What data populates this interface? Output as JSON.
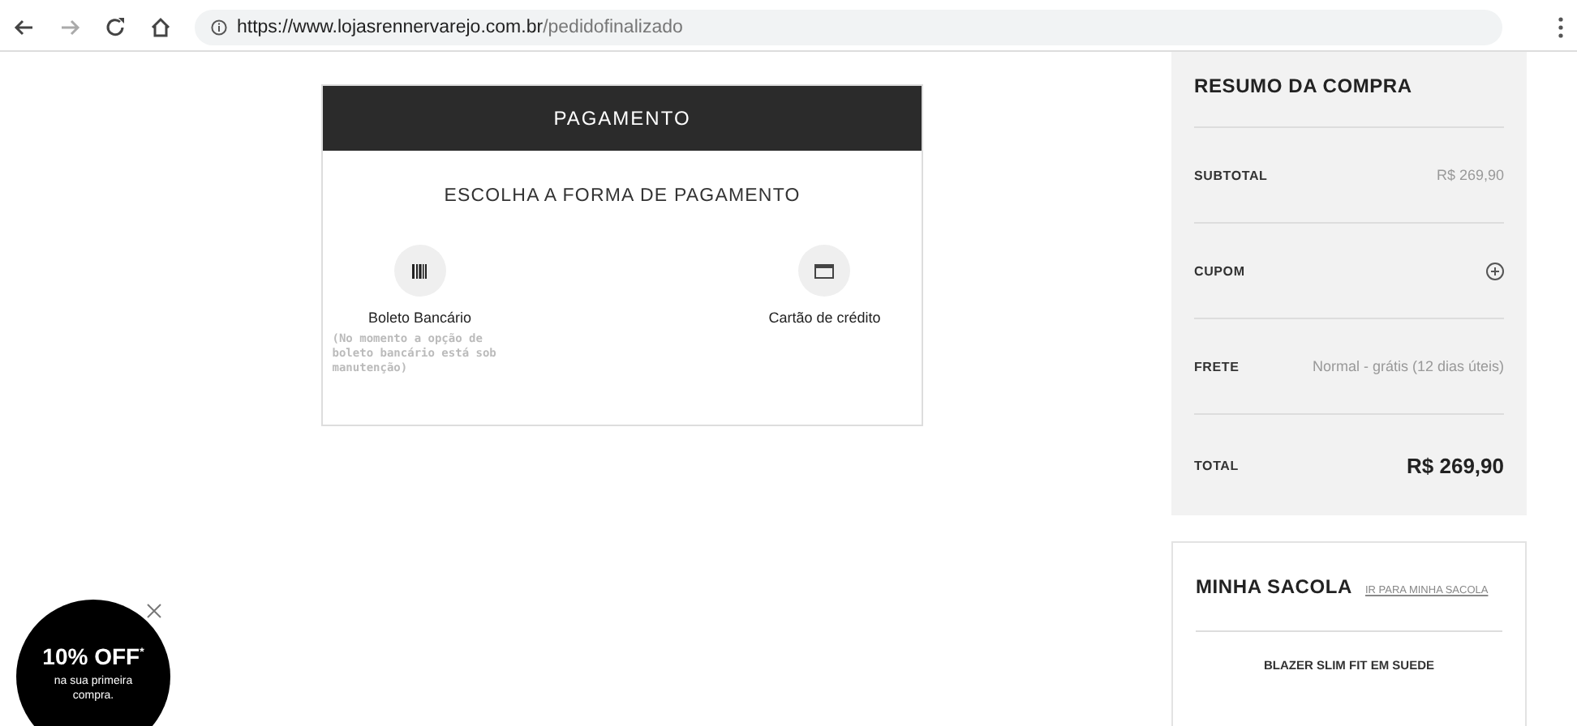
{
  "address_bar": {
    "host": "https://www.lojasrennervarejo.com.br",
    "path": "/pedidofinalizado"
  },
  "payment": {
    "header": "PAGAMENTO",
    "title": "ESCOLHA A FORMA DE PAGAMENTO",
    "options": [
      {
        "kind": "boleto",
        "label": "Boleto Bancário",
        "note": "(No momento a opção de boleto bancário está sob manutenção)"
      },
      {
        "kind": "card",
        "label": "Cartão de crédito"
      }
    ]
  },
  "summary": {
    "title": "RESUMO DA COMPRA",
    "rows": [
      {
        "kind": "value",
        "label": "SUBTOTAL",
        "value": "R$ 269,90"
      },
      {
        "kind": "add",
        "label": "CUPOM"
      },
      {
        "kind": "value",
        "label": "FRETE",
        "value": "Normal - grátis (12 dias úteis)"
      },
      {
        "kind": "total",
        "label": "TOTAL",
        "value": "R$ 269,90"
      }
    ]
  },
  "bag": {
    "title": "MINHA SACOLA",
    "link": "IR PARA MINHA SACOLA",
    "item": "BLAZER SLIM FIT EM SUEDE"
  },
  "promo": {
    "headline": "10% OFF",
    "mark": "*",
    "text": "na sua primeira compra."
  }
}
